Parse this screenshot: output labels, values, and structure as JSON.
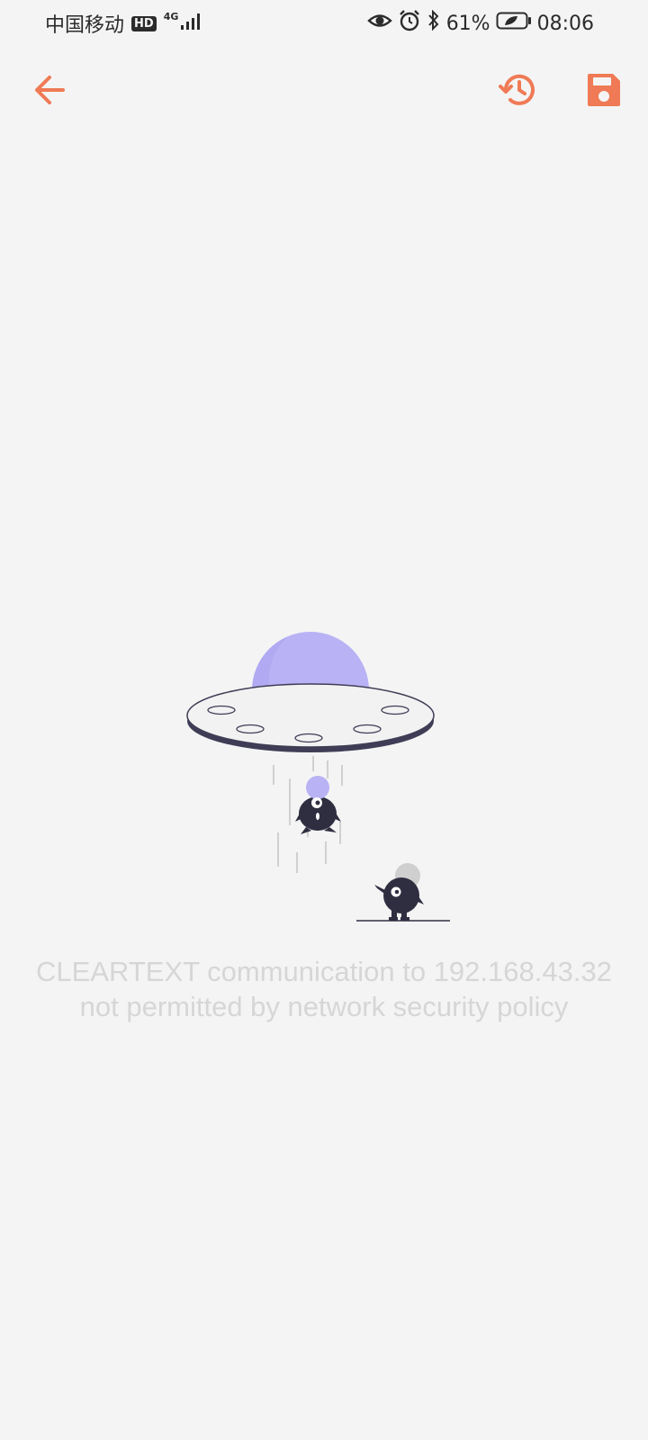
{
  "status_bar": {
    "carrier": "中国移动",
    "hd": "HD",
    "network": "4G",
    "battery_percent": "61%",
    "time": "08:06"
  },
  "app_bar": {
    "accent_color": "#ef7a55",
    "icons": [
      "arrow-back-icon",
      "history-icon",
      "save-icon"
    ]
  },
  "error": {
    "message": "CLEARTEXT communication to 192.168.43.32 not permitted by network security policy"
  },
  "colors": {
    "background": "#f4f4f4",
    "accent": "#ef7a55",
    "illustration_purple": "#b9b2f5",
    "illustration_dark": "#2f2e41",
    "message_text": "#d6d6d6"
  }
}
